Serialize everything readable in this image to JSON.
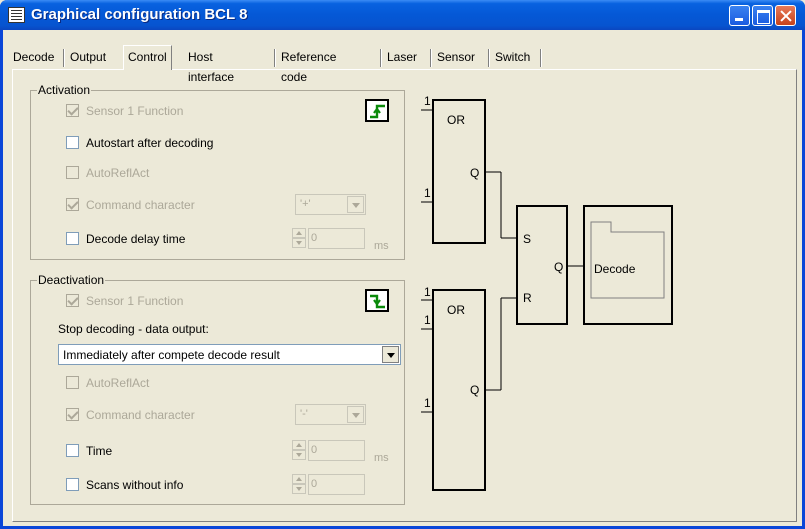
{
  "window": {
    "title": "Graphical configuration BCL 8"
  },
  "tabs": [
    "Decode",
    "Output",
    "Control",
    "Host interface",
    "Reference code",
    "Laser",
    "Sensor",
    "Switch"
  ],
  "activation": {
    "title": "Activation",
    "sensor1": "Sensor 1 Function",
    "autostart": "Autostart after decoding",
    "autoreflact": "AutoReflAct",
    "command_char": "Command character",
    "command_value": "'+'",
    "decode_delay": "Decode delay time",
    "delay_value": "0",
    "delay_unit": "ms"
  },
  "deactivation": {
    "title": "Deactivation",
    "sensor1": "Sensor 1 Function",
    "stop_label": "Stop decoding - data output:",
    "stop_value": "Immediately after compete decode result",
    "autoreflact": "AutoReflAct",
    "command_char": "Command character",
    "command_value": "'-'",
    "time": "Time",
    "time_value": "0",
    "time_unit": "ms",
    "scans": "Scans without info",
    "scans_value": "0"
  },
  "diagram": {
    "gate1": "OR",
    "gate2": "OR",
    "q1": "Q",
    "q2": "Q",
    "in1a": "1",
    "in1b": "1",
    "in2a": "1",
    "in2b": "1",
    "in2c": "1",
    "s": "S",
    "r": "R",
    "qff": "Q",
    "decode": "Decode"
  },
  "colors": {
    "accent": "#0a8a0a",
    "title_bar": "#0558d6"
  }
}
